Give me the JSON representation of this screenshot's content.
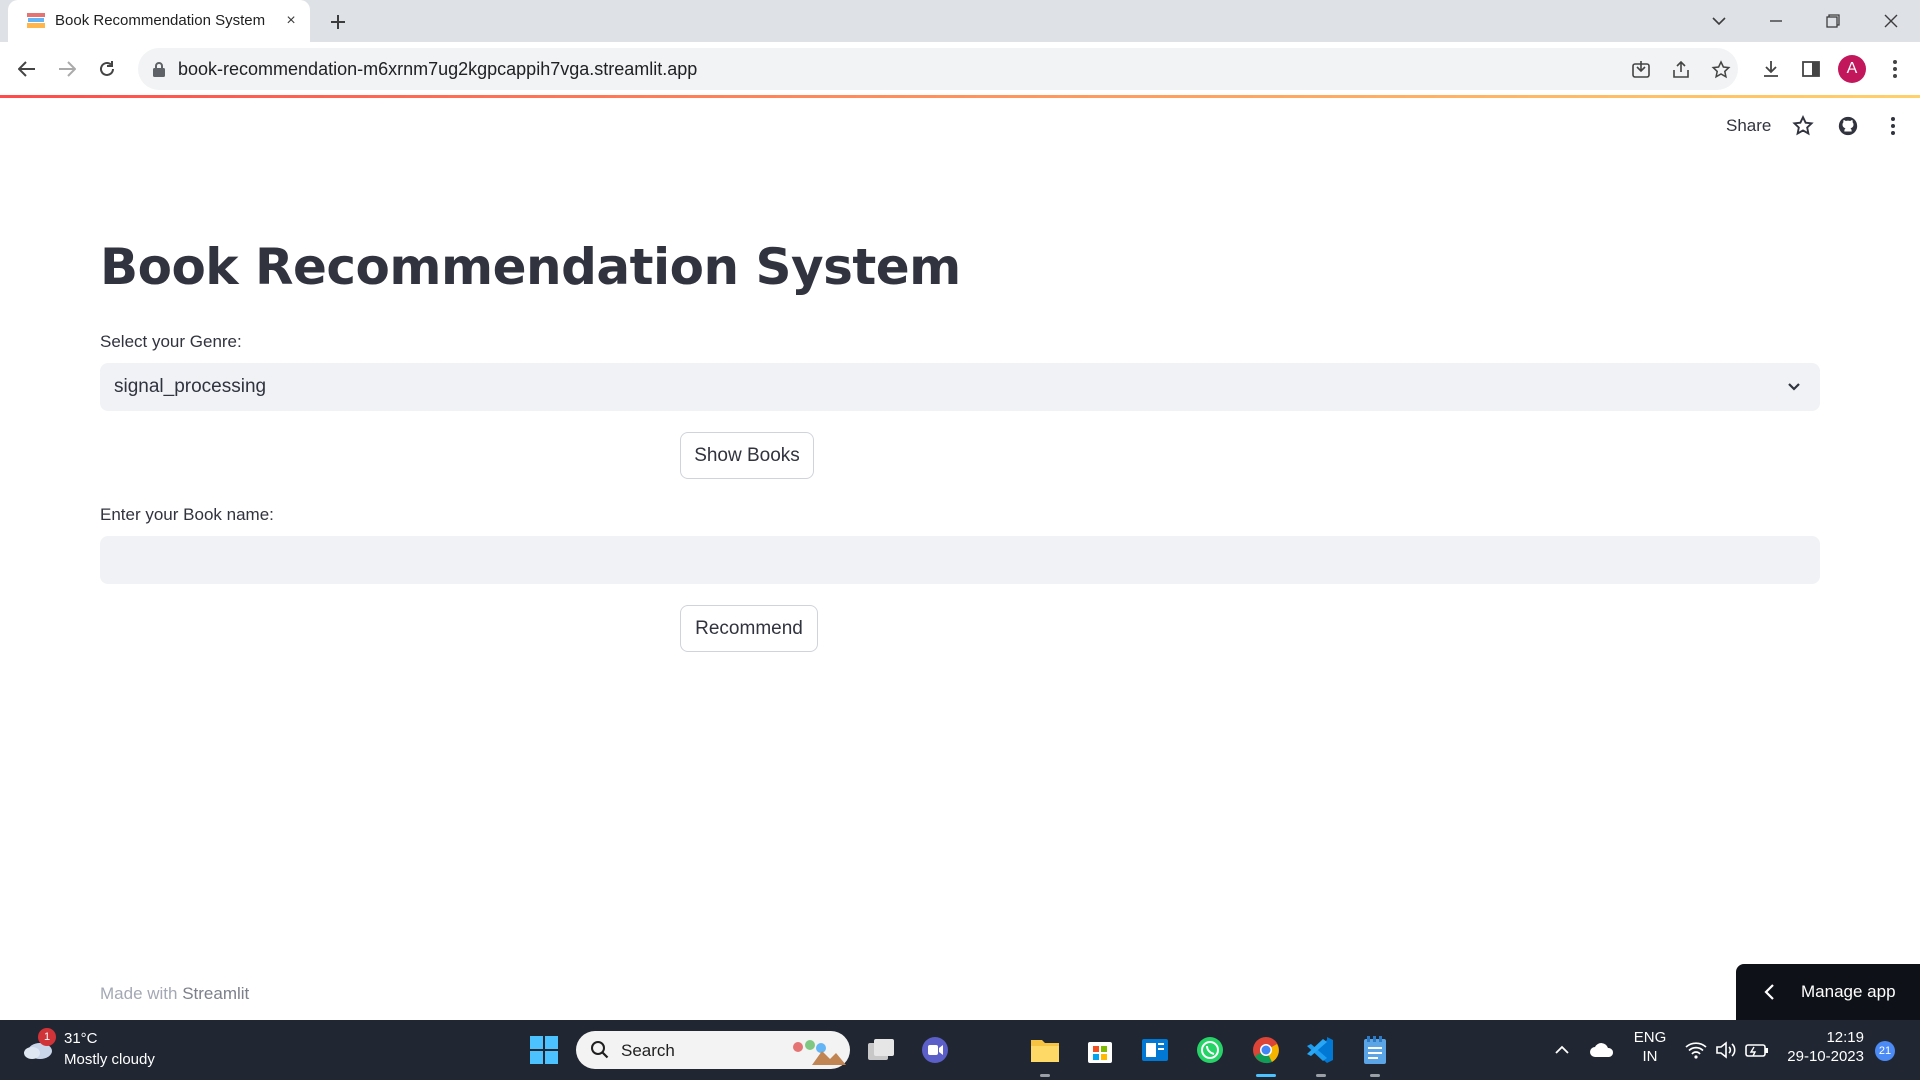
{
  "browser": {
    "tab_title": "Book Recommendation System",
    "tab_close": "×",
    "url": "book-recommendation-m6xrnm7ug2kgpcappih7vga.streamlit.app",
    "avatar_letter": "A",
    "progress_fraction": 1.0
  },
  "st_header": {
    "share_label": "Share"
  },
  "page": {
    "title": "Book Recommendation System",
    "genre_label": "Select your Genre:",
    "genre_value": "signal_processing",
    "show_books_label": "Show Books",
    "book_label": "Enter your Book name:",
    "book_value": "",
    "recommend_label": "Recommend"
  },
  "footer": {
    "prefix": "Made with ",
    "brand": "Streamlit"
  },
  "manage_app": {
    "label": "Manage app"
  },
  "taskbar": {
    "weather_badge": "1",
    "weather_temp": "31°C",
    "weather_desc": "Mostly cloudy",
    "search_label": "Search",
    "lang_top": "ENG",
    "lang_bottom": "IN",
    "time": "12:19",
    "date": "29-10-2023",
    "notification_count": "21"
  },
  "colors": {
    "accent_red": "#ff4b4b",
    "input_bg": "#f0f2f6",
    "text_primary": "#31333f",
    "manage_bg": "#0e1117",
    "taskbar_bg": "#202732"
  },
  "icons": [
    "book-favicon-icon",
    "close-icon",
    "plus-icon",
    "chevron-down-icon",
    "minimize-icon",
    "restore-icon",
    "back-icon",
    "forward-icon",
    "reload-icon",
    "lock-icon",
    "install-icon",
    "share-page-icon",
    "bookmark-star-icon",
    "download-icon",
    "side-panel-icon",
    "kebab-menu-icon",
    "star-icon",
    "github-icon",
    "windows-start-icon",
    "search-icon",
    "task-view-icon",
    "meet-icon",
    "file-explorer-icon",
    "store-icon",
    "news-icon",
    "whatsapp-icon",
    "chrome-icon",
    "vscode-icon",
    "notepad-icon",
    "chevron-up-icon",
    "onedrive-icon",
    "wifi-icon",
    "volume-icon",
    "battery-icon"
  ]
}
